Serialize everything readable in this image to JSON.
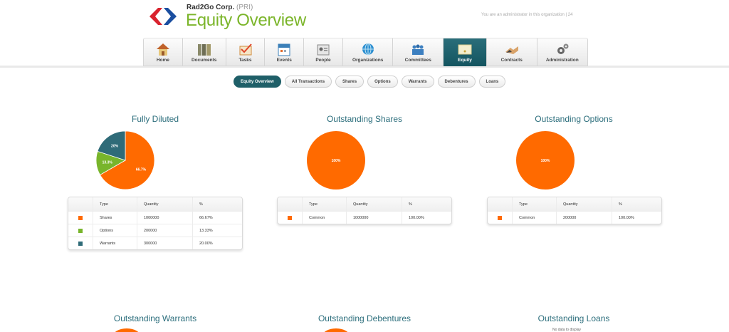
{
  "header": {
    "company_name": "Rad2Go Corp.",
    "company_code": "(PRI)",
    "page_title": "Equity Overview",
    "admin_note": "You are an administrator in this organization | 24"
  },
  "nav": {
    "items": [
      {
        "label": "Home",
        "icon": "home-icon"
      },
      {
        "label": "Documents",
        "icon": "documents-icon"
      },
      {
        "label": "Tasks",
        "icon": "tasks-icon"
      },
      {
        "label": "Events",
        "icon": "calendar-icon"
      },
      {
        "label": "People",
        "icon": "people-icon"
      },
      {
        "label": "Organizations",
        "icon": "globe-icon"
      },
      {
        "label": "Committees",
        "icon": "committees-icon"
      },
      {
        "label": "Equity",
        "icon": "equity-icon",
        "active": true
      },
      {
        "label": "Contracts",
        "icon": "contracts-icon"
      },
      {
        "label": "Administration",
        "icon": "gears-icon"
      }
    ]
  },
  "subtabs": [
    {
      "label": "Equity Overview",
      "active": true
    },
    {
      "label": "All Transactions"
    },
    {
      "label": "Shares"
    },
    {
      "label": "Options"
    },
    {
      "label": "Warrants"
    },
    {
      "label": "Debentures"
    },
    {
      "label": "Loans"
    }
  ],
  "colors": {
    "shares": "#ff6a00",
    "options": "#78b52b",
    "warrants": "#2f6b78",
    "title_green": "#7bb52a",
    "title_teal": "#2c6e7c",
    "active_nav": "#1f5f68"
  },
  "table_headers": {
    "type": "Type",
    "quantity": "Quantity",
    "percent": "%"
  },
  "panels": {
    "fully_diluted": {
      "title": "Fully Diluted",
      "slice_labels": [
        "66.7%",
        "13.3%",
        "20%"
      ],
      "rows": [
        {
          "type": "Shares",
          "quantity": "1000000",
          "percent": "66.67%",
          "color": "#ff6a00"
        },
        {
          "type": "Options",
          "quantity": "200000",
          "percent": "13.33%",
          "color": "#78b52b"
        },
        {
          "type": "Warrants",
          "quantity": "300000",
          "percent": "20.00%",
          "color": "#2f6b78"
        }
      ]
    },
    "outstanding_shares": {
      "title": "Outstanding Shares",
      "slice_label": "100%",
      "rows": [
        {
          "type": "Common",
          "quantity": "1000000",
          "percent": "100.00%",
          "color": "#ff6a00"
        }
      ]
    },
    "outstanding_options": {
      "title": "Outstanding Options",
      "slice_label": "100%",
      "rows": [
        {
          "type": "Common",
          "quantity": "200000",
          "percent": "100.00%",
          "color": "#ff6a00"
        }
      ]
    },
    "outstanding_warrants": {
      "title": "Outstanding Warrants"
    },
    "outstanding_debentures": {
      "title": "Outstanding Debentures"
    },
    "outstanding_loans": {
      "title": "Outstanding Loans",
      "no_data": "No data to display"
    }
  },
  "chart_data": [
    {
      "type": "pie",
      "title": "Fully Diluted",
      "categories": [
        "Shares",
        "Options",
        "Warrants"
      ],
      "values": [
        66.67,
        13.33,
        20.0
      ],
      "colors": [
        "#ff6a00",
        "#78b52b",
        "#2f6b78"
      ]
    },
    {
      "type": "pie",
      "title": "Outstanding Shares",
      "categories": [
        "Common"
      ],
      "values": [
        100
      ],
      "colors": [
        "#ff6a00"
      ]
    },
    {
      "type": "pie",
      "title": "Outstanding Options",
      "categories": [
        "Common"
      ],
      "values": [
        100
      ],
      "colors": [
        "#ff6a00"
      ]
    }
  ]
}
